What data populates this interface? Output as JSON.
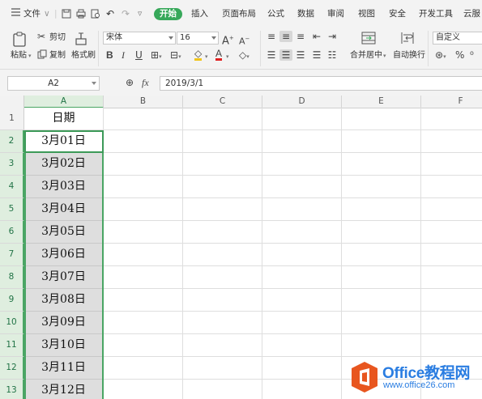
{
  "menu": {
    "file": "文件",
    "tabs": [
      "开始",
      "插入",
      "页面布局",
      "公式",
      "数据",
      "审阅",
      "视图",
      "安全",
      "开发工具",
      "云服"
    ]
  },
  "ribbon": {
    "paste": "粘贴",
    "cut": "剪切",
    "copy": "复制",
    "format_painter": "格式刷",
    "font_name": "宋体",
    "font_size": "16",
    "merge_center": "合并居中",
    "wrap_text": "自动换行",
    "number_format": "自定义"
  },
  "formula_bar": {
    "name_box": "A2",
    "fx": "fx",
    "value": "2019/3/1"
  },
  "sheet": {
    "columns": [
      "A",
      "B",
      "C",
      "D",
      "E",
      "F"
    ],
    "rows": [
      "1",
      "2",
      "3",
      "4",
      "5",
      "6",
      "7",
      "8",
      "9",
      "10",
      "11",
      "12",
      "13"
    ],
    "colA": [
      "日期",
      "3月01日",
      "3月02日",
      "3月03日",
      "3月04日",
      "3月05日",
      "3月06日",
      "3月07日",
      "3月08日",
      "3月09日",
      "3月10日",
      "3月11日",
      "3月12日"
    ]
  },
  "watermark": {
    "title": "Office教程网",
    "url": "www.office26.com"
  },
  "colors": {
    "accent_green": "#37a85a",
    "selection_border": "#4aa564",
    "watermark_blue": "#2a7de1",
    "logo_orange": "#e8561f"
  }
}
